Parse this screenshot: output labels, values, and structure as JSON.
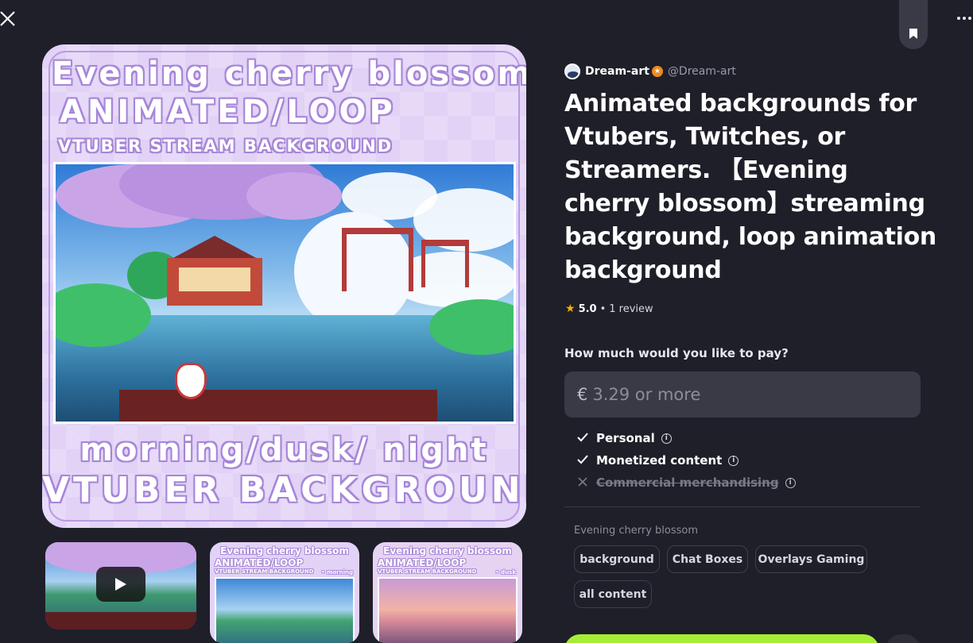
{
  "header": {
    "close_icon": "close-icon",
    "bookmark_icon": "bookmark-icon",
    "more_icon": "more-horizontal-icon"
  },
  "artwork": {
    "line1": "Evening cherry blossom",
    "line2": "ANIMATED/LOOP",
    "line3": "VTUBER STREAM BACKGROUND",
    "line4": "morning/dusk/ night",
    "line5": "VTUBER  BACKGROUND",
    "accent_color": "#e2d2f6"
  },
  "thumbnails": [
    {
      "type": "video",
      "icon": "play-icon"
    },
    {
      "type": "image",
      "line1": "Evening cherry blossom",
      "line2": "ANIMATED/LOOP",
      "line3": "VTUBER STREAM BACKGROUND",
      "variant": "• morning"
    },
    {
      "type": "image",
      "line1": "Evening cherry blossom",
      "line2": "ANIMATED/LOOP",
      "line3": "VTUBER STREAM BACKGROUND",
      "variant": "• dusk"
    }
  ],
  "creator": {
    "name": "Dream-art",
    "handle": "@Dream-art",
    "badge_color": "#f08a1c"
  },
  "product": {
    "title": "Animated backgrounds for Vtubers, Twitches, or Streamers. 【Evening cherry blossom】streaming background, loop animation background",
    "rating": "5.0",
    "rating_separator": "•",
    "reviews": "1 review"
  },
  "pricing": {
    "question": "How much would you like to pay?",
    "currency": "€",
    "placeholder": "3.29 or more"
  },
  "licenses": [
    {
      "label": "Personal",
      "included": true
    },
    {
      "label": "Monetized content",
      "included": true
    },
    {
      "label": "Commercial merchandising",
      "included": false
    }
  ],
  "collection": "Evening cherry blossom",
  "tags": [
    "background",
    "Chat Boxes",
    "Overlays Gaming",
    "all content"
  ],
  "colors": {
    "background": "#1f1f29",
    "panel": "#3a3a46",
    "buy_button": "#a6ee34",
    "star": "#f5b400"
  }
}
